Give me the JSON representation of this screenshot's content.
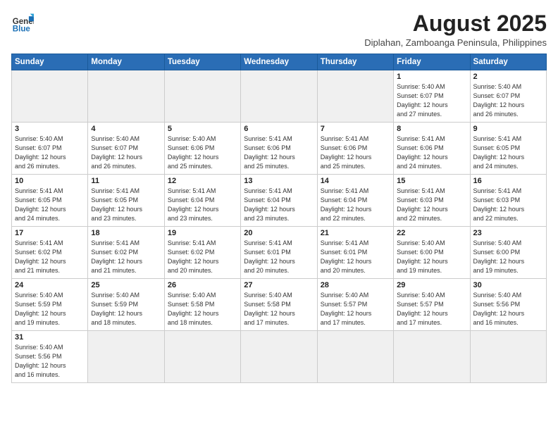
{
  "header": {
    "logo_general": "General",
    "logo_blue": "Blue",
    "month_title": "August 2025",
    "location": "Diplahan, Zamboanga Peninsula, Philippines"
  },
  "days_of_week": [
    "Sunday",
    "Monday",
    "Tuesday",
    "Wednesday",
    "Thursday",
    "Friday",
    "Saturday"
  ],
  "weeks": [
    [
      {
        "day": "",
        "info": "",
        "empty": true
      },
      {
        "day": "",
        "info": "",
        "empty": true
      },
      {
        "day": "",
        "info": "",
        "empty": true
      },
      {
        "day": "",
        "info": "",
        "empty": true
      },
      {
        "day": "",
        "info": "",
        "empty": true
      },
      {
        "day": "1",
        "info": "Sunrise: 5:40 AM\nSunset: 6:07 PM\nDaylight: 12 hours\nand 27 minutes."
      },
      {
        "day": "2",
        "info": "Sunrise: 5:40 AM\nSunset: 6:07 PM\nDaylight: 12 hours\nand 26 minutes."
      }
    ],
    [
      {
        "day": "3",
        "info": "Sunrise: 5:40 AM\nSunset: 6:07 PM\nDaylight: 12 hours\nand 26 minutes."
      },
      {
        "day": "4",
        "info": "Sunrise: 5:40 AM\nSunset: 6:07 PM\nDaylight: 12 hours\nand 26 minutes."
      },
      {
        "day": "5",
        "info": "Sunrise: 5:40 AM\nSunset: 6:06 PM\nDaylight: 12 hours\nand 25 minutes."
      },
      {
        "day": "6",
        "info": "Sunrise: 5:41 AM\nSunset: 6:06 PM\nDaylight: 12 hours\nand 25 minutes."
      },
      {
        "day": "7",
        "info": "Sunrise: 5:41 AM\nSunset: 6:06 PM\nDaylight: 12 hours\nand 25 minutes."
      },
      {
        "day": "8",
        "info": "Sunrise: 5:41 AM\nSunset: 6:06 PM\nDaylight: 12 hours\nand 24 minutes."
      },
      {
        "day": "9",
        "info": "Sunrise: 5:41 AM\nSunset: 6:05 PM\nDaylight: 12 hours\nand 24 minutes."
      }
    ],
    [
      {
        "day": "10",
        "info": "Sunrise: 5:41 AM\nSunset: 6:05 PM\nDaylight: 12 hours\nand 24 minutes."
      },
      {
        "day": "11",
        "info": "Sunrise: 5:41 AM\nSunset: 6:05 PM\nDaylight: 12 hours\nand 23 minutes."
      },
      {
        "day": "12",
        "info": "Sunrise: 5:41 AM\nSunset: 6:04 PM\nDaylight: 12 hours\nand 23 minutes."
      },
      {
        "day": "13",
        "info": "Sunrise: 5:41 AM\nSunset: 6:04 PM\nDaylight: 12 hours\nand 23 minutes."
      },
      {
        "day": "14",
        "info": "Sunrise: 5:41 AM\nSunset: 6:04 PM\nDaylight: 12 hours\nand 22 minutes."
      },
      {
        "day": "15",
        "info": "Sunrise: 5:41 AM\nSunset: 6:03 PM\nDaylight: 12 hours\nand 22 minutes."
      },
      {
        "day": "16",
        "info": "Sunrise: 5:41 AM\nSunset: 6:03 PM\nDaylight: 12 hours\nand 22 minutes."
      }
    ],
    [
      {
        "day": "17",
        "info": "Sunrise: 5:41 AM\nSunset: 6:02 PM\nDaylight: 12 hours\nand 21 minutes."
      },
      {
        "day": "18",
        "info": "Sunrise: 5:41 AM\nSunset: 6:02 PM\nDaylight: 12 hours\nand 21 minutes."
      },
      {
        "day": "19",
        "info": "Sunrise: 5:41 AM\nSunset: 6:02 PM\nDaylight: 12 hours\nand 20 minutes."
      },
      {
        "day": "20",
        "info": "Sunrise: 5:41 AM\nSunset: 6:01 PM\nDaylight: 12 hours\nand 20 minutes."
      },
      {
        "day": "21",
        "info": "Sunrise: 5:41 AM\nSunset: 6:01 PM\nDaylight: 12 hours\nand 20 minutes."
      },
      {
        "day": "22",
        "info": "Sunrise: 5:40 AM\nSunset: 6:00 PM\nDaylight: 12 hours\nand 19 minutes."
      },
      {
        "day": "23",
        "info": "Sunrise: 5:40 AM\nSunset: 6:00 PM\nDaylight: 12 hours\nand 19 minutes."
      }
    ],
    [
      {
        "day": "24",
        "info": "Sunrise: 5:40 AM\nSunset: 5:59 PM\nDaylight: 12 hours\nand 19 minutes."
      },
      {
        "day": "25",
        "info": "Sunrise: 5:40 AM\nSunset: 5:59 PM\nDaylight: 12 hours\nand 18 minutes."
      },
      {
        "day": "26",
        "info": "Sunrise: 5:40 AM\nSunset: 5:58 PM\nDaylight: 12 hours\nand 18 minutes."
      },
      {
        "day": "27",
        "info": "Sunrise: 5:40 AM\nSunset: 5:58 PM\nDaylight: 12 hours\nand 17 minutes."
      },
      {
        "day": "28",
        "info": "Sunrise: 5:40 AM\nSunset: 5:57 PM\nDaylight: 12 hours\nand 17 minutes."
      },
      {
        "day": "29",
        "info": "Sunrise: 5:40 AM\nSunset: 5:57 PM\nDaylight: 12 hours\nand 17 minutes."
      },
      {
        "day": "30",
        "info": "Sunrise: 5:40 AM\nSunset: 5:56 PM\nDaylight: 12 hours\nand 16 minutes."
      }
    ],
    [
      {
        "day": "31",
        "info": "Sunrise: 5:40 AM\nSunset: 5:56 PM\nDaylight: 12 hours\nand 16 minutes."
      },
      {
        "day": "",
        "info": "",
        "empty": true
      },
      {
        "day": "",
        "info": "",
        "empty": true
      },
      {
        "day": "",
        "info": "",
        "empty": true
      },
      {
        "day": "",
        "info": "",
        "empty": true
      },
      {
        "day": "",
        "info": "",
        "empty": true
      },
      {
        "day": "",
        "info": "",
        "empty": true
      }
    ]
  ]
}
